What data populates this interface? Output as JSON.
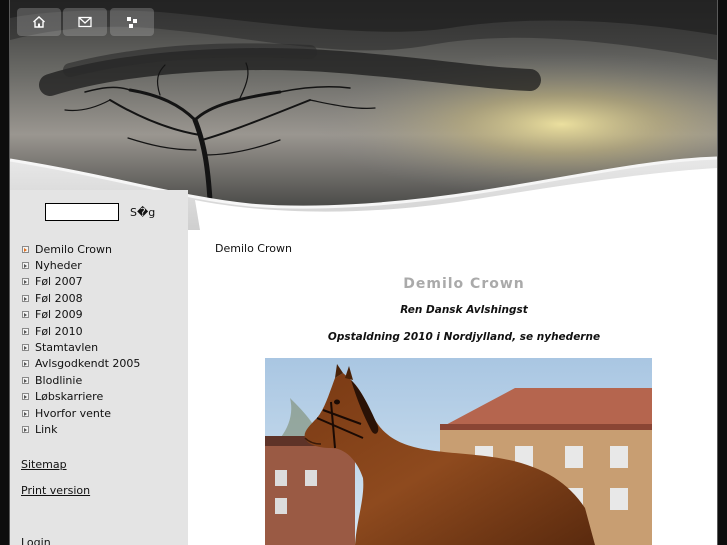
{
  "topnav": {
    "home_icon": "home-icon",
    "mail_icon": "mail-icon",
    "sitemap_icon": "sitemap-icon"
  },
  "search": {
    "value": "",
    "button_label": "S�g"
  },
  "nav": {
    "items": [
      {
        "label": "Demilo Crown",
        "active": true
      },
      {
        "label": "Nyheder"
      },
      {
        "label": "Føl 2007"
      },
      {
        "label": "Føl 2008"
      },
      {
        "label": "Føl 2009"
      },
      {
        "label": "Føl 2010"
      },
      {
        "label": "Stamtavlen"
      },
      {
        "label": "Avlsgodkendt 2005"
      },
      {
        "label": "Blodlinie"
      },
      {
        "label": "Løbskarriere"
      },
      {
        "label": "Hvorfor vente"
      },
      {
        "label": "Link"
      }
    ],
    "sitemap": "Sitemap",
    "print": "Print version",
    "login": "Login"
  },
  "content": {
    "breadcrumb": "Demilo Crown",
    "title": "Demilo Crown",
    "subtitle": "Ren Dansk Avlshingst",
    "note": "Opstaldning 2010 i Nordjylland, se nyhederne"
  },
  "colors": {
    "page_bg": "#0d0d0d",
    "sidebar_bg": "#e4e4e4",
    "title_gray": "#aaaaaa",
    "active_bullet": "#e07020"
  }
}
